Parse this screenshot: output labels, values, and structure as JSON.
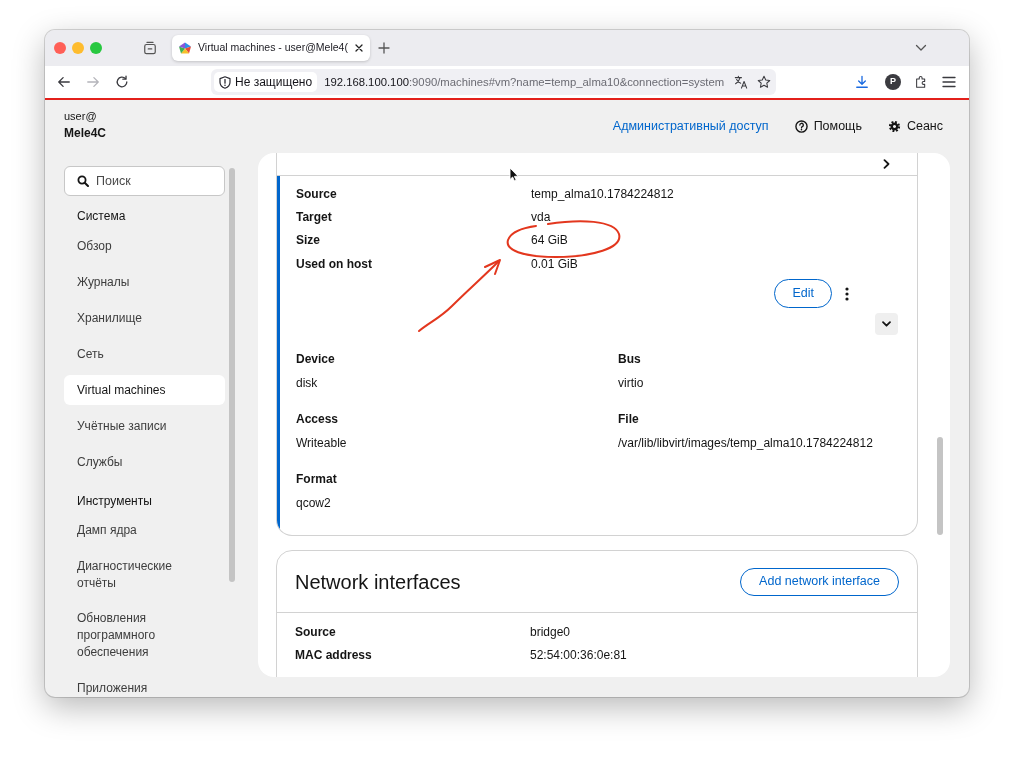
{
  "browser": {
    "tabs": [
      {
        "title": "Virtual machines - user@Mele4(",
        "selected": true
      }
    ],
    "nav_buttons": [
      {
        "kind": "back",
        "disabled": false
      },
      {
        "kind": "forward",
        "disabled": true
      },
      {
        "kind": "reload",
        "disabled": false
      }
    ],
    "address_bar": {
      "security_label": "Не защищено",
      "host": "192.168.100.100",
      "path": ":9090/machines#vm?name=temp_alma10&connection=system"
    },
    "profile_initial": "P"
  },
  "host": {
    "user": "user@",
    "name": "Mele4C"
  },
  "top_links": [
    {
      "kind": "link",
      "label": "Административный доступ"
    },
    {
      "kind": "help",
      "label": "Помощь"
    },
    {
      "kind": "settings",
      "label": "Сеанс"
    }
  ],
  "sidebar": {
    "search": {
      "placeholder": "Поиск"
    },
    "sections": [
      {
        "heading": "Система",
        "items": [
          {
            "label": "Обзор",
            "selected": false
          },
          {
            "label": "Журналы",
            "selected": false
          },
          {
            "label": "Хранилище",
            "selected": false
          },
          {
            "label": "Сеть",
            "selected": false
          },
          {
            "label": "Virtual machines",
            "selected": true
          },
          {
            "label": "Учётные записи",
            "selected": false
          },
          {
            "label": "Службы",
            "selected": false
          }
        ]
      },
      {
        "heading": "Инструменты",
        "items": [
          {
            "label": "Дамп ядра",
            "selected": false
          },
          {
            "label": "Диагностические отчёты",
            "selected": false
          },
          {
            "label": "Обновления программного обеспечения",
            "selected": false
          },
          {
            "label": "Приложения",
            "selected": false
          }
        ]
      }
    ]
  },
  "disk": {
    "summary": [
      {
        "label": "Source",
        "value": "temp_alma10.1784224812"
      },
      {
        "label": "Target",
        "value": "vda"
      },
      {
        "label": "Size",
        "value": "64 GiB"
      },
      {
        "label": "Used on host",
        "value": "0.01 GiB"
      }
    ],
    "edit_button": "Edit",
    "properties": [
      {
        "label": "Device",
        "value": "disk"
      },
      {
        "label": "Bus",
        "value": "virtio"
      },
      {
        "label": "Access",
        "value": "Writeable"
      },
      {
        "label": "File",
        "value": "/var/lib/libvirt/images/temp_alma10.1784224812"
      },
      {
        "label": "Format",
        "value": "qcow2"
      }
    ]
  },
  "network_interfaces": {
    "title": "Network interfaces",
    "add_button": "Add network interface",
    "rows": [
      {
        "label": "Source",
        "value": "bridge0"
      },
      {
        "label": "MAC address",
        "value": "52:54:00:36:0e:81"
      }
    ]
  }
}
